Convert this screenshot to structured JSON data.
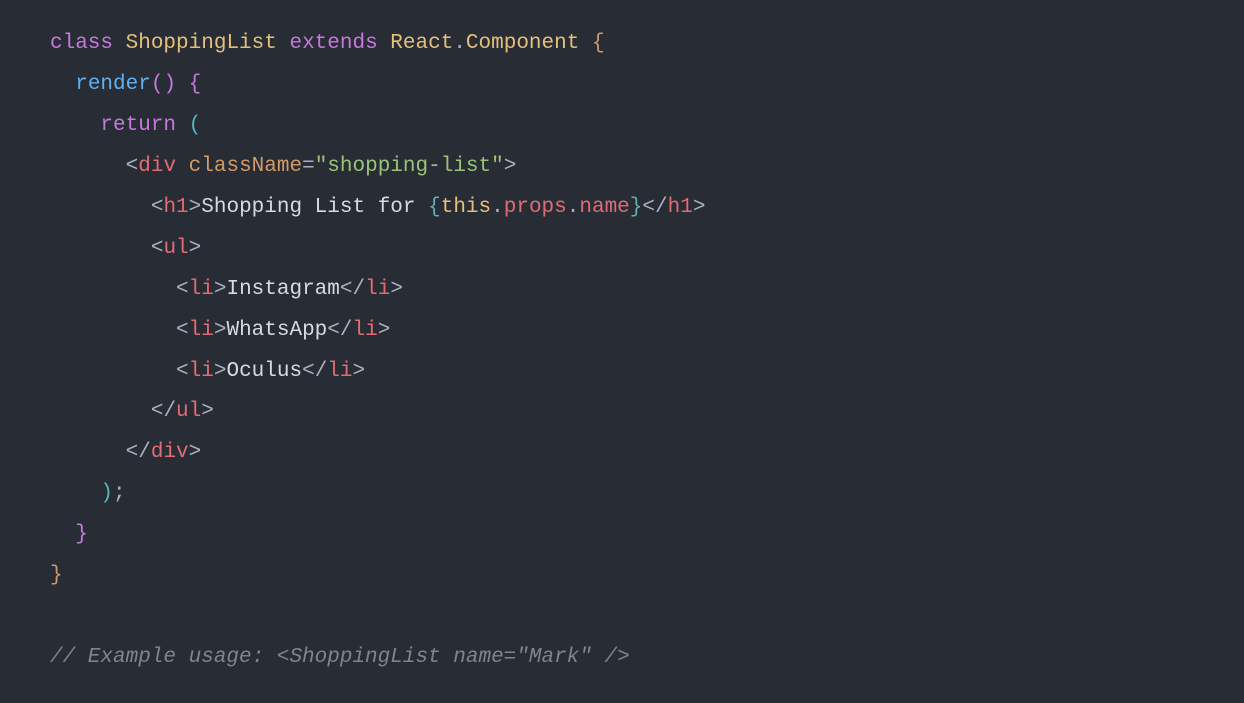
{
  "code": {
    "kw_class": "class",
    "class_name": "ShoppingList",
    "kw_extends": "extends",
    "react": "React",
    "dot1": ".",
    "component": "Component",
    "space": " ",
    "obr1": "{",
    "method_render": "render",
    "parens": "()",
    "obr2": "{",
    "kw_return": "return",
    "oparen3": "(",
    "lt": "<",
    "gt": ">",
    "slash": "/",
    "tag_div": "div",
    "attr_className": "className",
    "eq": "=",
    "q": "\"",
    "val_className": "shopping-list",
    "tag_h1": "h1",
    "text_h1": "Shopping List for ",
    "jsx_open": "{",
    "kw_this": "this",
    "props": "props",
    "name": "name",
    "jsx_close": "}",
    "tag_ul": "ul",
    "tag_li": "li",
    "li1": "Instagram",
    "li2": "WhatsApp",
    "li3": "Oculus",
    "cparen3": ")",
    "semi": ";",
    "cbr2": "}",
    "cbr1": "}",
    "comment": "// Example usage: <ShoppingList name=\"Mark\" />"
  }
}
